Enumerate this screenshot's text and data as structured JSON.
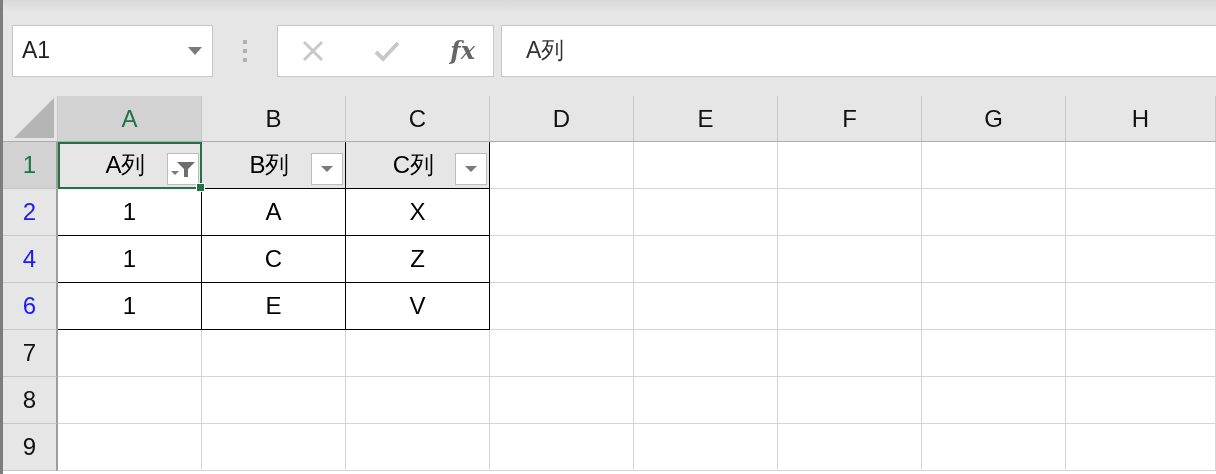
{
  "name_box": {
    "value": "A1"
  },
  "formula_bar": {
    "function_label": "fx",
    "value": "A列"
  },
  "columns": [
    {
      "label": "A",
      "selected": true
    },
    {
      "label": "B",
      "selected": false
    },
    {
      "label": "C",
      "selected": false
    },
    {
      "label": "D",
      "selected": false
    },
    {
      "label": "E",
      "selected": false
    },
    {
      "label": "F",
      "selected": false
    },
    {
      "label": "G",
      "selected": false
    },
    {
      "label": "H",
      "selected": false
    }
  ],
  "rows": [
    {
      "number": "1",
      "kind": "header",
      "selected": true,
      "filtered": false,
      "cells": [
        {
          "text": "A列",
          "active": true,
          "filter_applied": true
        },
        {
          "text": "B列",
          "active": false,
          "filter_applied": false
        },
        {
          "text": "C列",
          "active": false,
          "filter_applied": false
        }
      ]
    },
    {
      "number": "2",
      "kind": "data",
      "selected": false,
      "filtered": true,
      "cells": [
        {
          "text": "1",
          "active": false
        },
        {
          "text": "A",
          "active": false
        },
        {
          "text": "X",
          "active": false
        }
      ]
    },
    {
      "number": "4",
      "kind": "data",
      "selected": false,
      "filtered": true,
      "cells": [
        {
          "text": "1",
          "active": false
        },
        {
          "text": "C",
          "active": false
        },
        {
          "text": "Z",
          "active": false
        }
      ]
    },
    {
      "number": "6",
      "kind": "data",
      "selected": false,
      "filtered": true,
      "cells": [
        {
          "text": "1",
          "active": false
        },
        {
          "text": "E",
          "active": false
        },
        {
          "text": "V",
          "active": false
        }
      ]
    },
    {
      "number": "7",
      "kind": "empty",
      "selected": false,
      "filtered": false,
      "cells": []
    },
    {
      "number": "8",
      "kind": "empty",
      "selected": false,
      "filtered": false,
      "cells": []
    },
    {
      "number": "9",
      "kind": "empty",
      "selected": false,
      "filtered": false,
      "cells": []
    }
  ]
}
